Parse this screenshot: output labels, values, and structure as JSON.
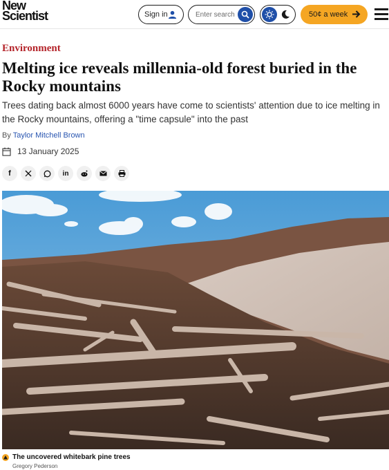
{
  "header": {
    "logo_line1": "New",
    "logo_line2": "Scientist",
    "signin_label": "Sign in",
    "search_placeholder": "Enter search",
    "subscribe_label": "50¢ a week",
    "colors": {
      "accent_blue": "#1f4fa8",
      "subscribe_orange": "#f5a623"
    }
  },
  "article": {
    "section": "Environment",
    "headline": "Melting ice reveals millennia-old forest buried in the Rocky mountains",
    "standfirst": "Trees dating back almost 6000 years have come to scientists' attention due to ice melting in the Rocky mountains, offering a \"time capsule\" into the past",
    "byline_prefix": "By",
    "author": "Taylor Mitchell Brown",
    "date": "13 January 2025",
    "share_icons": [
      "facebook-icon",
      "x-icon",
      "whatsapp-icon",
      "linkedin-icon",
      "reddit-icon",
      "email-icon",
      "print-icon"
    ],
    "section_color": "#b4242a"
  },
  "image": {
    "caption": "The uncovered whitebark pine trees",
    "credit": "Gregory Pederson"
  }
}
